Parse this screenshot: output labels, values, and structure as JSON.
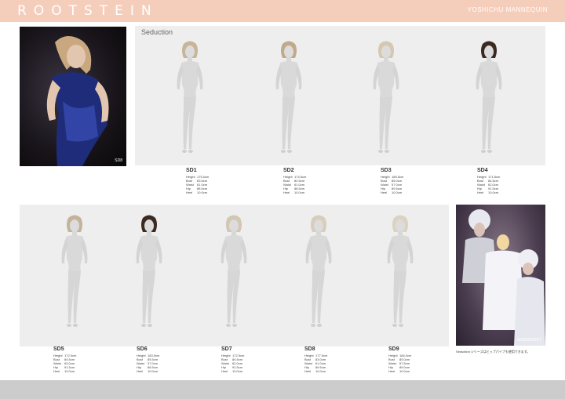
{
  "header": {
    "brand": "ROOTSTEIN",
    "subbrand": "YOSHICHU MANNEQUIN"
  },
  "colors": {
    "header_bar": "#f5cdbb",
    "panel": "#eeeeee",
    "footer_bar": "#cccccc"
  },
  "photos": {
    "sd8_tag": "SD8",
    "group_tag": "SD8/SX5/SD7",
    "group_caption": "Seduction シリーズはヒップパイプも使用できます。"
  },
  "series_title": "Seduction",
  "labels": {
    "height": "Height",
    "bust": "Bust",
    "waist": "Waist",
    "hip": "Hip",
    "heel": "Heel"
  },
  "models": [
    {
      "code": "SD1",
      "height": "175.0cm",
      "bust": "83.5cm",
      "waist": "61.0cm",
      "hip": "88.5cm",
      "heel": "10.0cm"
    },
    {
      "code": "SD2",
      "height": "174.5cm",
      "bust": "82.5cm",
      "waist": "61.0cm",
      "hip": "88.5cm",
      "heel": "10.0cm"
    },
    {
      "code": "SD3",
      "height": "185.5cm",
      "bust": "85.0cm",
      "waist": "57.0cm",
      "hip": "89.5cm",
      "heel": "10.0cm"
    },
    {
      "code": "SD4",
      "height": "171.5cm",
      "bust": "84.5cm",
      "waist": "62.0cm",
      "hip": "91.5cm",
      "heel": "10.0cm"
    },
    {
      "code": "SD5",
      "height": "172.0cm",
      "bust": "84.5cm",
      "waist": "63.0cm",
      "hip": "91.5cm",
      "heel": "10.0cm"
    },
    {
      "code": "SD6",
      "height": "183.5cm",
      "bust": "85.5cm",
      "waist": "57.0cm",
      "hip": "86.5cm",
      "heel": "10.0cm"
    },
    {
      "code": "SD7",
      "height": "172.5cm",
      "bust": "84.5cm",
      "waist": "62.0cm",
      "hip": "91.5cm",
      "heel": "10.0cm"
    },
    {
      "code": "SD8",
      "height": "177.5cm",
      "bust": "83.0cm",
      "waist": "61.0cm",
      "hip": "89.5cm",
      "heel": "10.0cm"
    },
    {
      "code": "SD9",
      "height": "184.0cm",
      "bust": "85.0cm",
      "waist": "57.5cm",
      "hip": "89.0cm",
      "heel": "10.0cm"
    }
  ]
}
